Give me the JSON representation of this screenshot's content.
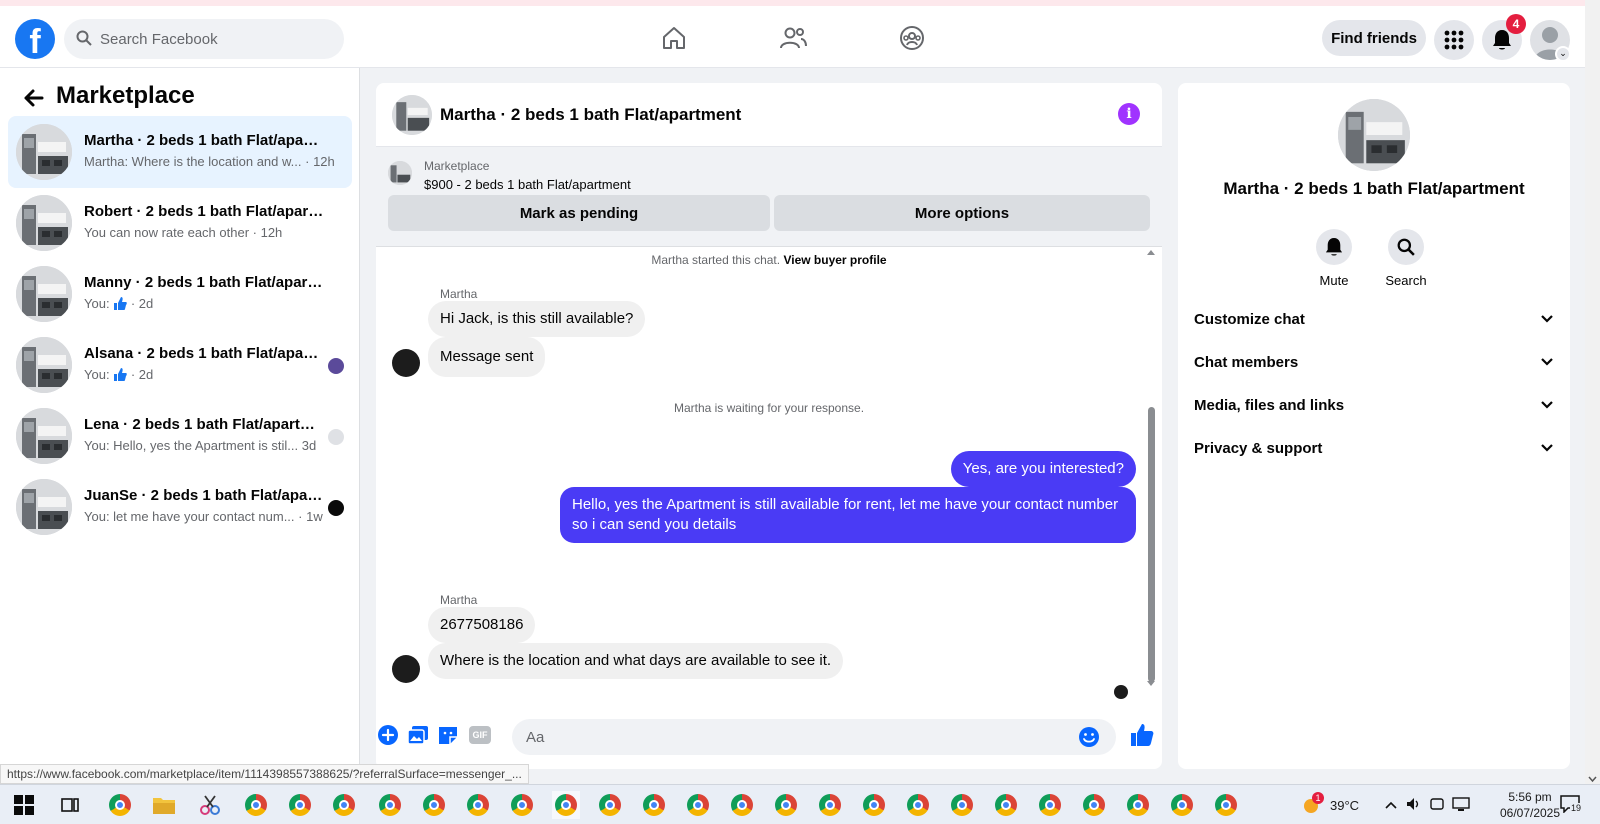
{
  "header": {
    "search_placeholder": "Search Facebook",
    "find_friends": "Find friends",
    "notification_count": "4"
  },
  "sidebar": {
    "title": "Marketplace",
    "conversations": [
      {
        "name": "Martha · 2 beds 1 bath Flat/apart...",
        "preview": "Martha: Where is the location and w...",
        "time": "· 12h",
        "active": true
      },
      {
        "name": "Robert · 2 beds 1 bath Flat/apartm...",
        "preview": "You can now rate each other",
        "time": "· 12h"
      },
      {
        "name": "Manny · 2 beds 1 bath Flat/apartm...",
        "preview": "You:",
        "time": "· 2d"
      },
      {
        "name": "Alsana · 2 beds 1 bath Flat/apart...",
        "preview": "You:",
        "time": "· 2d"
      },
      {
        "name": "Lena · 2 beds 1 bath Flat/apartm...",
        "preview": "You: Hello, yes the Apartment is stil...",
        "time": "3d"
      },
      {
        "name": "JuanSe · 2 beds 1 bath Flat/apar...",
        "preview": "You: let me have your contact num...",
        "time": "· 1w"
      }
    ]
  },
  "chat": {
    "title": "Martha · 2 beds 1 bath Flat/apartment",
    "marketplace_label": "Marketplace",
    "listing": "$900 - 2 beds 1 bath Flat/apartment",
    "mark_pending": "Mark as pending",
    "more_options": "More options",
    "started_text": "Martha started this chat.",
    "view_buyer": "View buyer profile",
    "sender1": "Martha",
    "msg1": "Hi Jack, is this still available?",
    "msg2": "Message sent",
    "waiting": "Martha is waiting for your response.",
    "out1": "Yes, are you interested?",
    "out2": "Hello, yes the Apartment is still available for rent, let me have your contact number so i can send you details",
    "sender2": "Martha",
    "msg3": "2677508186",
    "msg4": "Where is the location and what days are available to see it.",
    "input_placeholder": "Aa",
    "gif_label": "GIF"
  },
  "info": {
    "title": "Martha · 2 beds 1 bath Flat/apartment",
    "mute": "Mute",
    "search": "Search",
    "sections": [
      "Customize chat",
      "Chat members",
      "Media, files and links",
      "Privacy & support"
    ]
  },
  "status_url": "https://www.facebook.com/marketplace/item/1114398557388625/?referralSurface=messenger_...",
  "taskbar": {
    "temperature": "39°C",
    "weather_badge": "1",
    "time": "5:56 pm",
    "date": "06/07/2025",
    "notif_count": "19"
  },
  "colors": {
    "brand": "#1877f2",
    "outgoing_bubble": "#4a3bf5",
    "info_icon": "#a033ff",
    "badge": "#e41e3f"
  }
}
